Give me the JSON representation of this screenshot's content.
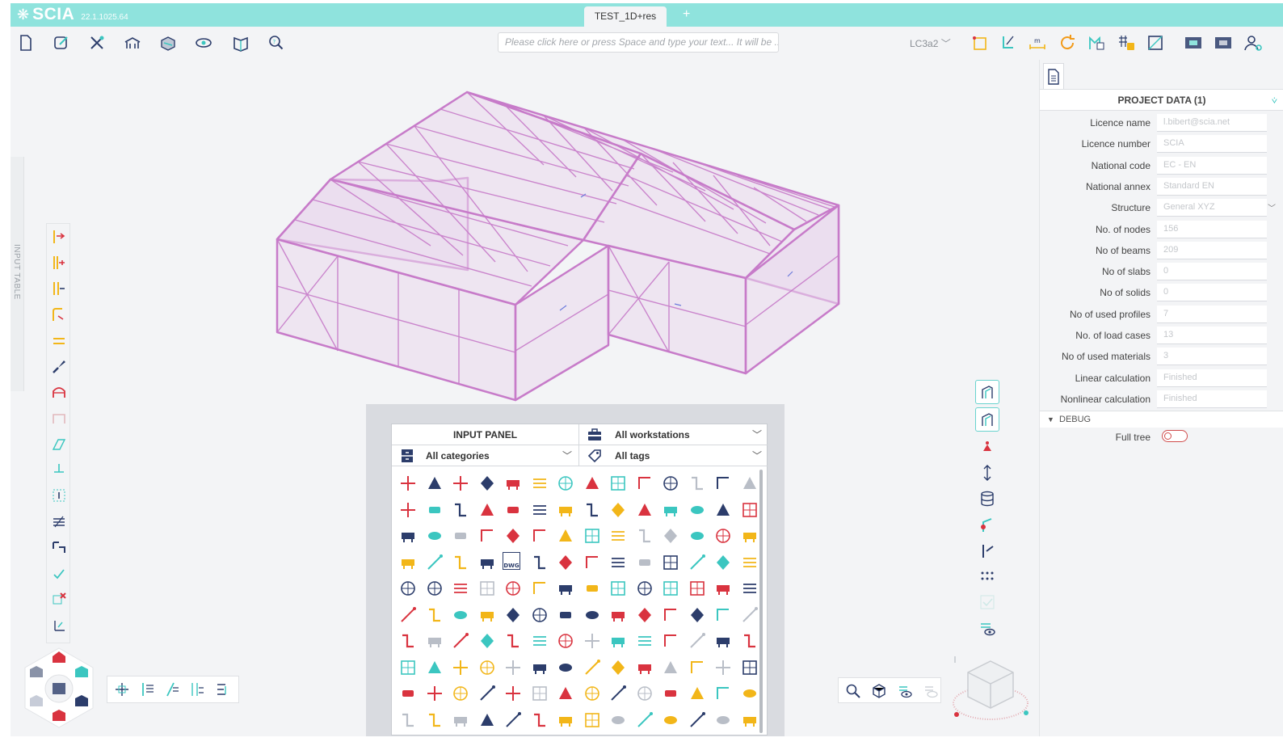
{
  "app": {
    "name": "SCIA",
    "version": "22.1.1025.64",
    "document_tab": "TEST_1D+res",
    "new_tab_symbol": "+"
  },
  "toolbar": {
    "left_icons": [
      "new-file-icon",
      "edit-icon",
      "tools-icon",
      "structure-icon",
      "load-icon",
      "view-icon",
      "report-icon",
      "search-help-icon"
    ],
    "command_placeholder": "Please click here or press Space and type your text... It will be ...",
    "load_case": "LC3a2",
    "right_icons": [
      "node-icon",
      "beam-icon",
      "dimension-icon",
      "refresh-icon",
      "result-icon",
      "lock-icon",
      "frame-icon",
      "grid-a-icon",
      "grid-b-icon",
      "user-icon"
    ]
  },
  "left_strip": {
    "label": "INPUT TABLE"
  },
  "input_panel": {
    "title": "INPUT PANEL",
    "workstations": "All workstations",
    "categories": "All categories",
    "tags": "All tags",
    "dwg_label": "DWG"
  },
  "project_data": {
    "header": "PROJECT DATA (1)",
    "rows": [
      {
        "label": "Licence name",
        "value": "l.bibert@scia.net"
      },
      {
        "label": "Licence number",
        "value": "SCIA"
      },
      {
        "label": "National code",
        "value": "EC - EN"
      },
      {
        "label": "National annex",
        "value": "Standard EN"
      },
      {
        "label": "Structure",
        "value": "General XYZ"
      },
      {
        "label": "No. of nodes",
        "value": "156"
      },
      {
        "label": "No of beams",
        "value": "209"
      },
      {
        "label": "No of slabs",
        "value": "0"
      },
      {
        "label": "No of solids",
        "value": "0"
      },
      {
        "label": "No of used profiles",
        "value": "7"
      },
      {
        "label": "No. of load cases",
        "value": "13"
      },
      {
        "label": "No of used materials",
        "value": "3"
      },
      {
        "label": "Linear calculation",
        "value": "Finished"
      },
      {
        "label": "Nonlinear calculation",
        "value": "Finished"
      }
    ],
    "debug_section": "DEBUG",
    "full_tree_label": "Full tree",
    "full_tree_enabled": false
  },
  "colors": {
    "titlebar": "#8fe3dd",
    "accent": "#3bc6c0",
    "structure": "#c77bc9",
    "icon_red": "#d9333f",
    "icon_yellow": "#f2b619",
    "icon_navy": "#2c3d6b"
  }
}
